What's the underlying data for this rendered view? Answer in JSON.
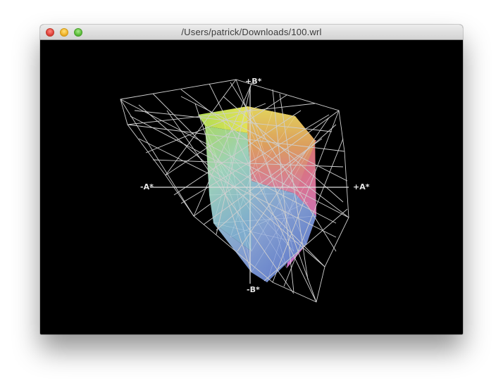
{
  "window": {
    "title": "/Users/patrick/Downloads/100.wrl"
  },
  "viewer": {
    "axes": {
      "plus_b": "+B*",
      "minus_b": "-B*",
      "plus_a": "+A*",
      "minus_a": "-A*"
    }
  },
  "colors": {
    "background": "#000000",
    "wireframe": "#cfcfcf",
    "gamut_yellow": "#f2f25a",
    "gamut_green": "#a8e05a",
    "gamut_cyan": "#9fd8d0",
    "gamut_blue": "#5f86d6",
    "gamut_magenta": "#e07ad8",
    "gamut_red": "#e8706a",
    "gamut_orange": "#e8a040"
  }
}
